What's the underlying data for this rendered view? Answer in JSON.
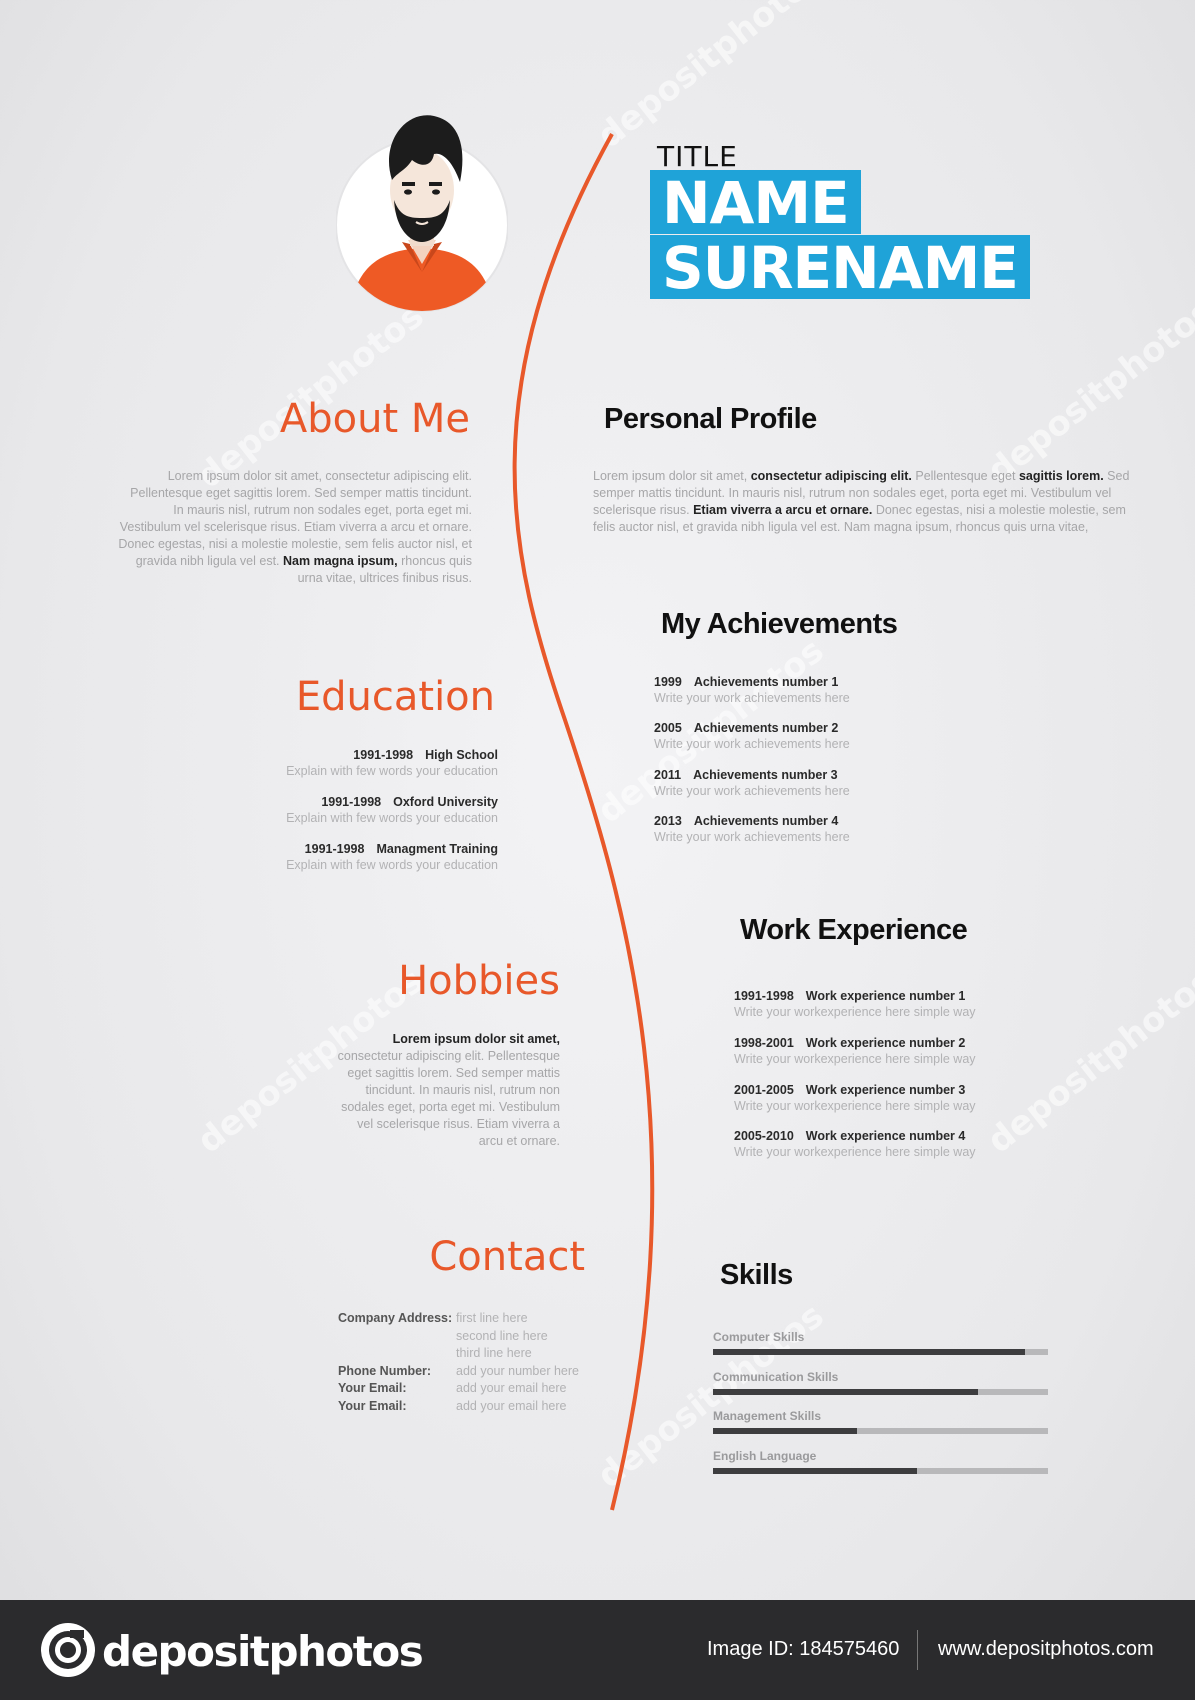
{
  "header": {
    "title_small": "TITLE",
    "name": "NAME",
    "surename": "SURENAME"
  },
  "colors": {
    "accent_orange": "#e8582a",
    "accent_blue": "#1fa3d8",
    "background": "#ececee"
  },
  "about": {
    "heading": "About Me",
    "text_pre": "Lorem ipsum dolor sit amet, consectetur adipiscing elit. Pellentesque eget sagittis lorem. Sed semper mattis tincidunt. In mauris nisl, rutrum non sodales eget, porta eget mi. Vestibulum vel scelerisque risus. Etiam viverra a arcu et ornare. Donec egestas, nisi a molestie molestie, sem felis auctor nisl, et gravida nibh ligula vel est.",
    "text_bold": "Nam magna ipsum,",
    "text_post": "rhoncus quis urna vitae, ultrices finibus risus."
  },
  "profile": {
    "heading": "Personal Profile",
    "t1": "Lorem ipsum dolor sit amet,",
    "b1": "consectetur adipiscing elit.",
    "t2": "Pellentesque eget",
    "b2": "sagittis lorem.",
    "t3": "Sed semper mattis tincidunt. In mauris nisl, rutrum non sodales eget, porta eget mi. Vestibulum vel scelerisque risus.",
    "b3": "Etiam viverra a arcu et ornare.",
    "t4": "Donec egestas, nisi a molestie molestie, sem felis auctor nisl, et gravida nibh ligula vel est. Nam magna ipsum, rhoncus quis urna vitae,"
  },
  "education": {
    "heading": "Education",
    "items": [
      {
        "years": "1991-1998",
        "title": "High School",
        "desc": "Explain with few words your education"
      },
      {
        "years": "1991-1998",
        "title": "Oxford University",
        "desc": "Explain with few words your education"
      },
      {
        "years": "1991-1998",
        "title": "Managment Training",
        "desc": "Explain with few words your education"
      }
    ]
  },
  "achievements": {
    "heading": "My Achievements",
    "items": [
      {
        "year": "1999",
        "title": "Achievements number 1",
        "desc": "Write your work achievements here"
      },
      {
        "year": "2005",
        "title": "Achievements number 2",
        "desc": "Write your work achievements here"
      },
      {
        "year": "2011",
        "title": "Achievements number 3",
        "desc": "Write your work achievements here"
      },
      {
        "year": "2013",
        "title": "Achievements number 4",
        "desc": "Write your work achievements here"
      }
    ]
  },
  "hobbies": {
    "heading": "Hobbies",
    "bold": "Lorem ipsum dolor sit amet,",
    "text": "consectetur adipiscing elit. Pellentesque eget sagittis lorem. Sed semper mattis tincidunt. In mauris nisl, rutrum non sodales eget, porta eget mi. Vestibulum vel scelerisque risus. Etiam viverra a arcu et ornare."
  },
  "work": {
    "heading": "Work Experience",
    "items": [
      {
        "years": "1991-1998",
        "title": "Work experience number 1",
        "desc": "Write your workexperience here simple way"
      },
      {
        "years": "1998-2001",
        "title": "Work experience number 2",
        "desc": "Write your workexperience here simple way"
      },
      {
        "years": "2001-2005",
        "title": "Work experience number 3",
        "desc": "Write your workexperience here simple way"
      },
      {
        "years": "2005-2010",
        "title": "Work experience number 4",
        "desc": "Write your workexperience here simple way"
      }
    ]
  },
  "contact": {
    "heading": "Contact",
    "address_label": "Company Address:",
    "address_lines": [
      "first line here",
      "second line here",
      "third line here"
    ],
    "phone_label": "Phone Number:",
    "phone_value": "add your number here",
    "email1_label": "Your Email:",
    "email1_value": "add your email here",
    "email2_label": "Your Email:",
    "email2_value": "add your email here"
  },
  "skills": {
    "heading": "Skills",
    "items": [
      {
        "label": "Computer Skills",
        "level": 0.93
      },
      {
        "label": "Communication Skills",
        "level": 0.79
      },
      {
        "label": "Management Skills",
        "level": 0.43
      },
      {
        "label": "English Language",
        "level": 0.61
      }
    ]
  },
  "watermark": "depositphotos",
  "footer": {
    "brand": "depositphotos",
    "image_id": "Image ID: 184575460",
    "url": "www.depositphotos.com"
  }
}
